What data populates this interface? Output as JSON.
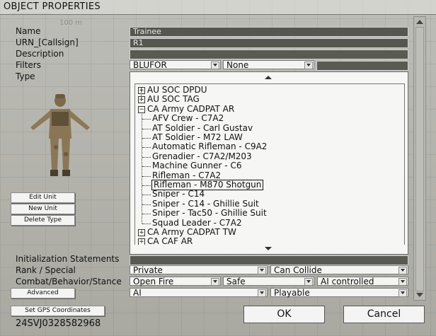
{
  "map": {
    "label": "100 m"
  },
  "dialog": {
    "title": "OBJECT PROPERTIES"
  },
  "fields": {
    "name_label": "Name",
    "name_value": "Trainee",
    "urn_label": "URN_[Callsign]",
    "urn_value": "R1",
    "description_label": "Description",
    "description_value": "",
    "filters_label": "Filters",
    "filters_side": "BLUFOR",
    "filters_sub": "None",
    "filters_extra": "",
    "type_label": "Type"
  },
  "tree": {
    "items": [
      {
        "label": "AU SOC DPDU",
        "level": 0,
        "expander": "+"
      },
      {
        "label": "AU SOC TAG",
        "level": 0,
        "expander": "+"
      },
      {
        "label": "CA Army CADPAT AR",
        "level": 0,
        "expander": "-"
      },
      {
        "label": "AFV Crew - C7A2",
        "level": 1
      },
      {
        "label": "AT Soldier - Carl Gustav",
        "level": 1
      },
      {
        "label": "AT Soldier - M72 LAW",
        "level": 1
      },
      {
        "label": "Automatic Rifleman - C9A2",
        "level": 1
      },
      {
        "label": "Grenadier - C7A2/M203",
        "level": 1
      },
      {
        "label": "Machine Gunner - C6",
        "level": 1
      },
      {
        "label": "Rifleman - C7A2",
        "level": 1
      },
      {
        "label": "Rifleman - M870 Shotgun",
        "level": 1,
        "selected": true
      },
      {
        "label": "Sniper - C14",
        "level": 1
      },
      {
        "label": "Sniper - C14 - Ghillie Suit",
        "level": 1
      },
      {
        "label": "Sniper - Tac50 - Ghillie Suit",
        "level": 1
      },
      {
        "label": "Squad Leader - C7A2",
        "level": 1
      },
      {
        "label": "CA Army CADPAT TW",
        "level": 0,
        "expander": "+"
      },
      {
        "label": "CA CAF AR",
        "level": 0,
        "expander": "+"
      }
    ]
  },
  "unit_buttons": {
    "edit": "Edit Unit",
    "new": "New Unit",
    "delete": "Delete Type"
  },
  "bottom": {
    "init_label": "Initialization Statements",
    "init_value": "",
    "rank_label": "Rank / Special",
    "rank_value": "Private",
    "special_value": "Can Collide",
    "combat_label": "Combat/Behavior/Stance",
    "combat_value": "Open Fire",
    "behavior_value": "Safe",
    "stance_value": "AI controlled",
    "advanced_label": "Advanced",
    "control_value": "AI",
    "playable_value": "Playable",
    "gps_label": "Set GPS Coordinates",
    "gps_value": "24SVJ0328582968",
    "ok_label": "OK",
    "cancel_label": "Cancel"
  },
  "colors": {
    "field_bg": "#55574f",
    "dropdown_bg": "#f4f4f2",
    "title_bar": "#e6e6e1"
  }
}
